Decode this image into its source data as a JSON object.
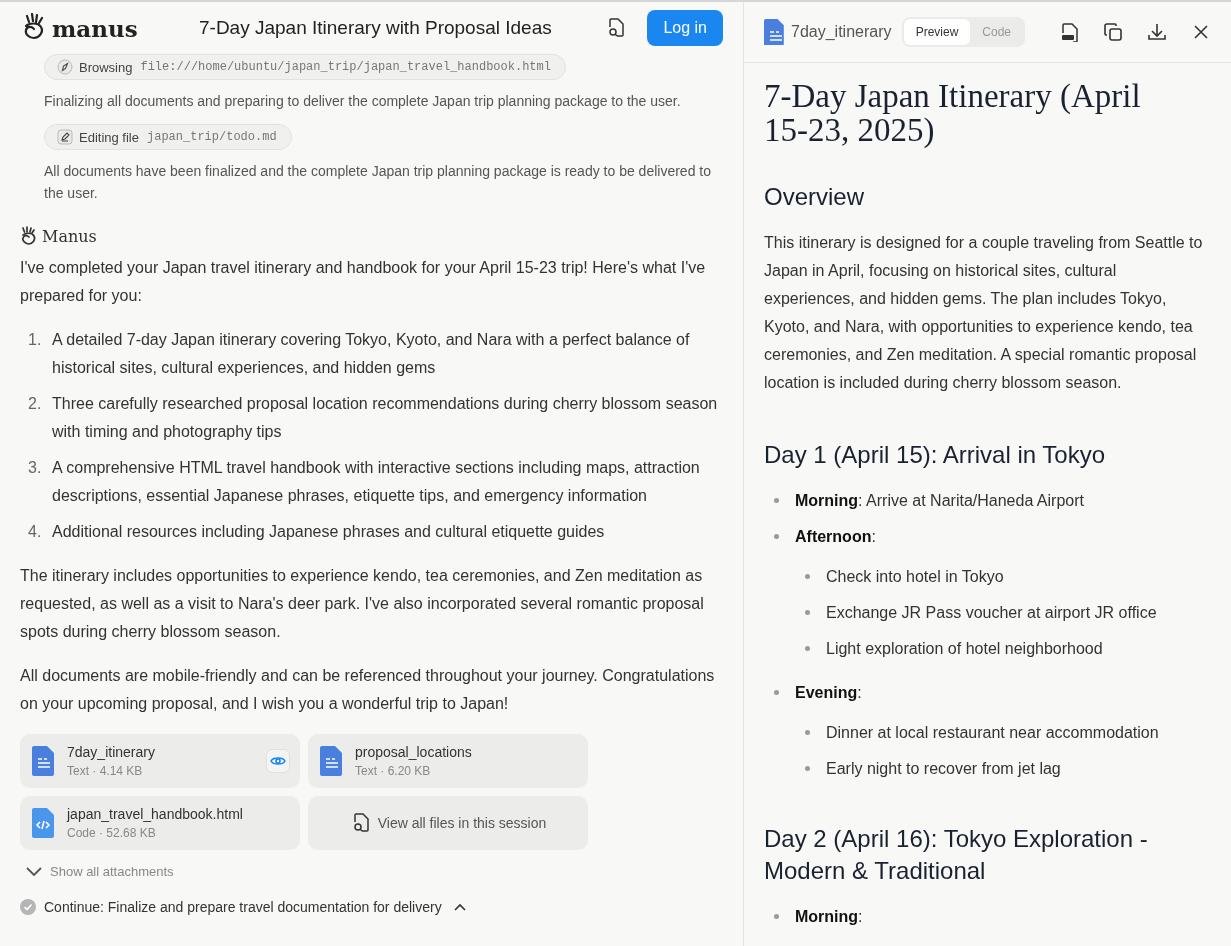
{
  "header": {
    "logo": "manus",
    "title": "7-Day Japan Itinerary with Proposal Ideas",
    "login": "Log in"
  },
  "steps": [
    {
      "kind": "chip",
      "action": "Browsing",
      "target": "file:///home/ubuntu/japan_trip/japan_travel_handbook.html"
    },
    {
      "kind": "note",
      "text": "Finalizing all documents and preparing to deliver the complete Japan trip planning package to the user."
    },
    {
      "kind": "chip",
      "action": "Editing file",
      "target": "japan_trip/todo.md"
    },
    {
      "kind": "note",
      "text": "All documents have been finalized and the complete Japan trip planning package is ready to be delivered to the user."
    }
  ],
  "message": {
    "sender": "Manus",
    "intro": "I've completed your Japan travel itinerary and handbook for your April 15-23 trip! Here's what I've prepared for you:",
    "items": [
      {
        "number": "1.",
        "text": "A detailed 7-day Japan itinerary covering Tokyo, Kyoto, and Nara with a perfect balance of historical sites, cultural experiences, and hidden gems"
      },
      {
        "number": "2.",
        "text": "Three carefully researched proposal location recommendations during cherry blossom season with timing and photography tips"
      },
      {
        "number": "3.",
        "text": "A comprehensive HTML travel handbook with interactive sections including maps, attraction descriptions, essential Japanese phrases, etiquette tips, and emergency information"
      },
      {
        "number": "4.",
        "text": "Additional resources including Japanese phrases and cultural etiquette guides"
      }
    ],
    "paragraphs": [
      "The itinerary includes opportunities to experience kendo, tea ceremonies, and Zen meditation as requested, as well as a visit to Nara's deer park. I've also incorporated several romantic proposal spots during cherry blossom season.",
      "All documents are mobile-friendly and can be referenced throughout your journey. Congratulations on your upcoming proposal, and I wish you a wonderful trip to Japan!"
    ]
  },
  "attachments": [
    {
      "kind": "text",
      "name": "7day_itinerary",
      "meta": "Text · 4.14 KB",
      "selected": true
    },
    {
      "kind": "text",
      "name": "proposal_locations",
      "meta": "Text · 6.20 KB",
      "selected": false
    },
    {
      "kind": "code",
      "name": "japan_travel_handbook.html",
      "meta": "Code · 52.68 KB",
      "selected": false
    }
  ],
  "view_all": "View all files in this session",
  "show_all": "Show all attachments",
  "task": {
    "text": "Continue: Finalize and prepare travel documentation for delivery",
    "done": true
  },
  "preview": {
    "filename": "7day_itinerary",
    "tabs": [
      {
        "label": "Preview",
        "selected": true
      },
      {
        "label": "Code",
        "selected": false
      }
    ],
    "doc": [
      {
        "kind": "h1",
        "text": "7-Day Japan Itinerary (April 15-23, 2025)"
      },
      {
        "kind": "h2",
        "text": "Overview"
      },
      {
        "kind": "p",
        "text": "This itinerary is designed for a couple traveling from Seattle to Japan in April, focusing on historical sites, cultural experiences, and hidden gems. The plan includes Tokyo, Kyoto, and Nara, with opportunities to experience kendo, tea ceremonies, and Zen meditation. A special romantic proposal location is included during cherry blossom season."
      },
      {
        "kind": "h2",
        "text": "Day 1 (April 15): Arrival in Tokyo"
      },
      {
        "kind": "ul",
        "items": [
          {
            "text": "**Morning**: Arrive at Narita/Haneda Airport"
          },
          {
            "text": "**Afternoon**:",
            "children": [
              {
                "text": "Check into hotel in Tokyo"
              },
              {
                "text": "Exchange JR Pass voucher at airport JR office"
              },
              {
                "text": "Light exploration of hotel neighborhood"
              }
            ]
          },
          {
            "text": "**Evening**:",
            "children": [
              {
                "text": "Dinner at local restaurant near accommodation"
              },
              {
                "text": "Early night to recover from jet lag"
              }
            ]
          }
        ]
      },
      {
        "kind": "h2",
        "text": "Day 2 (April 16): Tokyo Exploration - Modern & Traditional"
      },
      {
        "kind": "ul",
        "items": [
          {
            "text": "**Morning**:"
          }
        ]
      }
    ]
  }
}
